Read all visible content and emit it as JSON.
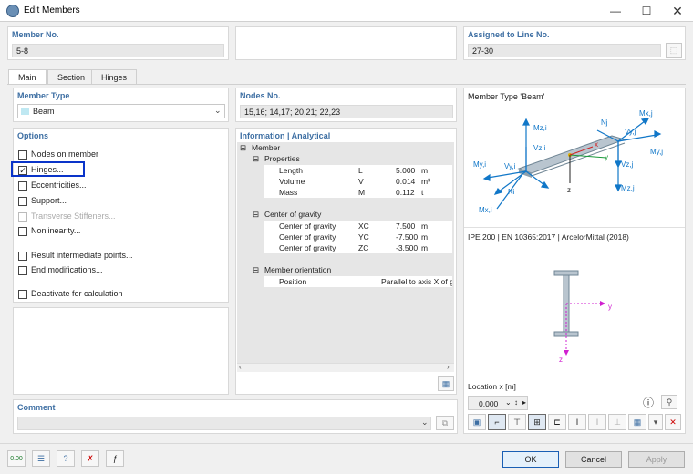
{
  "window": {
    "title": "Edit Members"
  },
  "header": {
    "member_no_label": "Member No.",
    "member_no_value": "5-8",
    "assigned_label": "Assigned to Line No.",
    "assigned_value": "27-30"
  },
  "tabs": [
    {
      "label": "Main"
    },
    {
      "label": "Section"
    },
    {
      "label": "Hinges"
    }
  ],
  "member_type": {
    "label": "Member Type",
    "value": "Beam"
  },
  "nodes": {
    "label": "Nodes No.",
    "value": "15,16; 14,17; 20,21; 22,23"
  },
  "options": {
    "label": "Options",
    "items": [
      {
        "label": "Nodes on member",
        "checked": false
      },
      {
        "label": "Hinges...",
        "checked": true
      },
      {
        "label": "Eccentricities...",
        "checked": false
      },
      {
        "label": "Support...",
        "checked": false
      },
      {
        "label": "Transverse Stiffeners...",
        "checked": false,
        "disabled": true
      },
      {
        "label": "Nonlinearity...",
        "checked": false
      },
      {
        "label": "Result intermediate points...",
        "checked": false
      },
      {
        "label": "End modifications...",
        "checked": false
      },
      {
        "label": "Deactivate for calculation",
        "checked": false
      }
    ]
  },
  "info": {
    "label": "Information | Analytical",
    "member": "Member",
    "properties": "Properties",
    "length": {
      "name": "Length",
      "sym": "L",
      "val": "5.000",
      "unit": "m"
    },
    "volume": {
      "name": "Volume",
      "sym": "V",
      "val": "0.014",
      "unit": "m³"
    },
    "mass": {
      "name": "Mass",
      "sym": "M",
      "val": "0.112",
      "unit": "t"
    },
    "cog": "Center of gravity",
    "cgx": {
      "name": "Center of gravity",
      "sym": "XC",
      "val": "7.500",
      "unit": "m"
    },
    "cgy": {
      "name": "Center of gravity",
      "sym": "YC",
      "val": "-7.500",
      "unit": "m"
    },
    "cgz": {
      "name": "Center of gravity",
      "sym": "ZC",
      "val": "-3.500",
      "unit": "m"
    },
    "orientation": "Member orientation",
    "position": {
      "name": "Position",
      "val": "Parallel to axis X of g"
    }
  },
  "preview": {
    "title": "Member Type 'Beam'",
    "section_text": "IPE 200 | EN 10365:2017 | ArcelorMittal (2018)",
    "location_label": "Location x [m]",
    "location_value": "0.000"
  },
  "diagram_labels": {
    "mzi": "Mz,i",
    "vzi": "Vz,i",
    "myi": "My,i",
    "vyi": "Vy,i",
    "ni": "Ni",
    "mxi": "Mx,i",
    "nj": "Nj",
    "mxj": "Mx,j",
    "vyj": "Vy,j",
    "myj": "My,j",
    "vzj": "Vz,j",
    "mzj": "Mz,j",
    "y": "y",
    "z": "z",
    "x": "x"
  },
  "section_axes": {
    "y": "y",
    "z": "z"
  },
  "comment": {
    "label": "Comment",
    "value": ""
  },
  "buttons": {
    "ok": "OK",
    "cancel": "Cancel",
    "apply": "Apply"
  },
  "toolbar_values": {
    "zero": "0.00"
  },
  "colors": {
    "accent": "#3e6fa3",
    "highlight": "#0a34c9",
    "arrow": "#1177c8"
  }
}
